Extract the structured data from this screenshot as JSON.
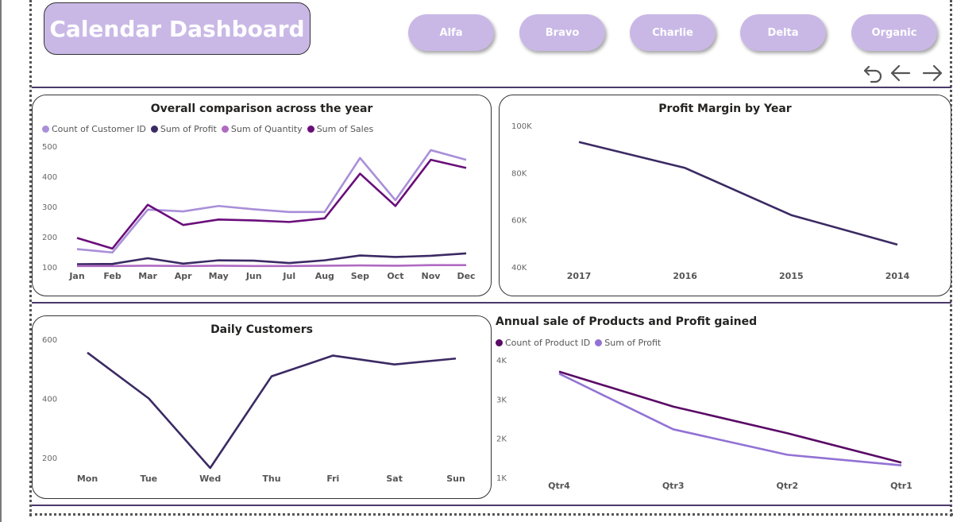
{
  "header": {
    "title": "Calendar Dashboard",
    "buttons": [
      "Alfa",
      "Bravo",
      "Charlie",
      "Delta",
      "Organic"
    ],
    "nav_icons": [
      "reset-icon",
      "back-arrow-icon",
      "forward-arrow-icon"
    ]
  },
  "colors": {
    "accent": "#c9b8e6",
    "count_customer": "#a98fd8",
    "profit": "#3b2a63",
    "quantity": "#b06ac2",
    "sales": "#6a0e7a",
    "product_count": "#5a0a66",
    "sum_profit_light": "#9272d4"
  },
  "chart_data": [
    {
      "type": "line",
      "title": "Overall comparison across the year",
      "categories": [
        "Jan",
        "Feb",
        "Mar",
        "Apr",
        "May",
        "Jun",
        "Jul",
        "Aug",
        "Sep",
        "Oct",
        "Nov",
        "Dec"
      ],
      "series": [
        {
          "name": "Count of Customer ID",
          "values": [
            159,
            148,
            290,
            284,
            302,
            291,
            282,
            282,
            461,
            321,
            487,
            455
          ]
        },
        {
          "name": "Sum of Profit",
          "values": [
            109,
            110,
            129,
            111,
            122,
            121,
            113,
            122,
            138,
            133,
            137,
            145
          ]
        },
        {
          "name": "Sum of Quantity",
          "values": [
            103,
            103,
            104,
            103,
            104,
            103,
            103,
            104,
            105,
            104,
            106,
            106
          ]
        },
        {
          "name": "Sum of Sales",
          "values": [
            196,
            161,
            306,
            239,
            257,
            254,
            249,
            261,
            409,
            302,
            455,
            428
          ]
        }
      ],
      "yticks": [
        "500",
        "400",
        "300",
        "200",
        "100"
      ],
      "ylim": [
        100,
        500
      ],
      "legend": "top-left"
    },
    {
      "type": "line",
      "title": "Profit Margin by Year",
      "categories": [
        "2017",
        "2016",
        "2015",
        "2014"
      ],
      "series": [
        {
          "values": [
            93000,
            82000,
            62000,
            49500
          ]
        }
      ],
      "yticks": [
        "100K",
        "80K",
        "60K",
        "40K"
      ],
      "ylim": [
        40000,
        100000
      ]
    },
    {
      "type": "line",
      "title": "Daily Customers",
      "categories": [
        "Mon",
        "Tue",
        "Wed",
        "Thu",
        "Fri",
        "Sat",
        "Sun"
      ],
      "series": [
        {
          "values": [
            555,
            400,
            165,
            475,
            545,
            515,
            535
          ]
        }
      ],
      "yticks": [
        "600",
        "400",
        "200"
      ],
      "ylim": [
        130,
        670
      ]
    },
    {
      "type": "line",
      "title": "Annual sale of Products and Profit gained",
      "categories": [
        "Qtr4",
        "Qtr3",
        "Qtr2",
        "Qtr1"
      ],
      "series": [
        {
          "name": "Count of Product ID",
          "values": [
            3700,
            2810,
            2130,
            1380
          ]
        },
        {
          "name": "Sum of Profit",
          "values": [
            3650,
            2230,
            1580,
            1310
          ]
        }
      ],
      "yticks": [
        "4K",
        "3K",
        "2K",
        "1K"
      ],
      "ylim": [
        1000,
        4000
      ],
      "legend": "top-left"
    }
  ]
}
